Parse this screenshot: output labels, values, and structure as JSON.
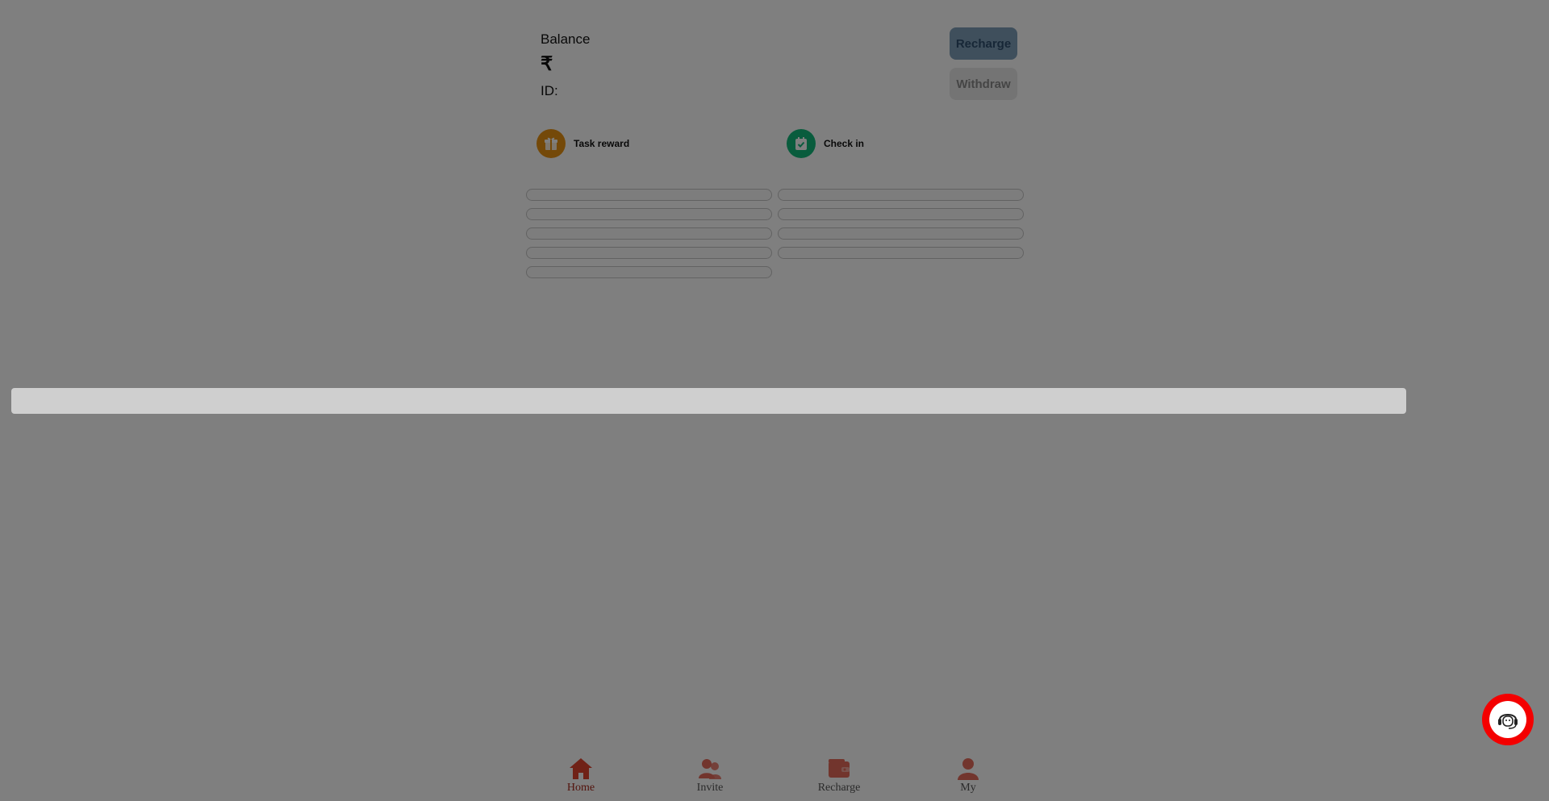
{
  "balance": {
    "label": "Balance",
    "currency_symbol": "₹",
    "id_label": "ID:"
  },
  "actions": {
    "recharge_label": "Recharge",
    "withdraw_label": "Withdraw"
  },
  "quick_links": [
    {
      "label": "Task reward",
      "icon": "gift-icon",
      "color": "#e99313"
    },
    {
      "label": "Check in",
      "icon": "calendar-check-icon",
      "color": "#12b97a"
    }
  ],
  "bottom_nav": [
    {
      "label": "Home",
      "icon": "home-icon",
      "active": true
    },
    {
      "label": "Invite",
      "icon": "users-icon",
      "active": false
    },
    {
      "label": "Recharge",
      "icon": "wallet-icon",
      "active": false
    },
    {
      "label": "My",
      "icon": "user-icon",
      "active": false
    }
  ],
  "support": {
    "icon": "customer-service-icon",
    "color": "#f40000"
  },
  "colors": {
    "accent": "#a6281a",
    "overlay": "rgba(0,0,0,0.5)"
  }
}
